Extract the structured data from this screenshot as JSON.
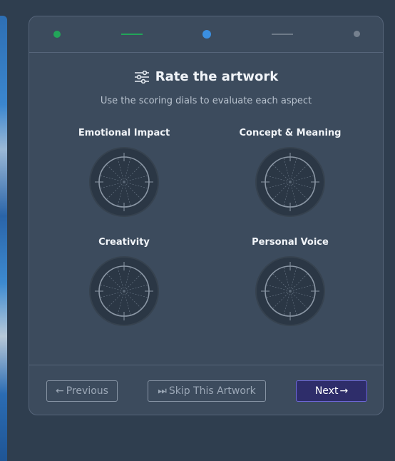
{
  "progress": {
    "steps": [
      "completed",
      "current",
      "upcoming"
    ]
  },
  "header": {
    "title": "Rate the artwork",
    "title_icon": "sliders-icon",
    "subtitle": "Use the scoring dials to evaluate each aspect"
  },
  "dials": [
    {
      "label": "Emotional Impact"
    },
    {
      "label": "Concept & Meaning"
    },
    {
      "label": "Creativity"
    },
    {
      "label": "Personal Voice"
    }
  ],
  "footer": {
    "previous_label": "Previous",
    "previous_icon": "arrow-left-icon",
    "skip_label": "Skip This Artwork",
    "skip_icon": "fast-forward-icon",
    "next_label": "Next",
    "next_icon": "arrow-right-icon"
  },
  "colors": {
    "background": "#2f3e4f",
    "card": "#3c4b5d",
    "completed": "#22a559",
    "current": "#3b8fe0",
    "next_button": "#2e2d6a"
  }
}
